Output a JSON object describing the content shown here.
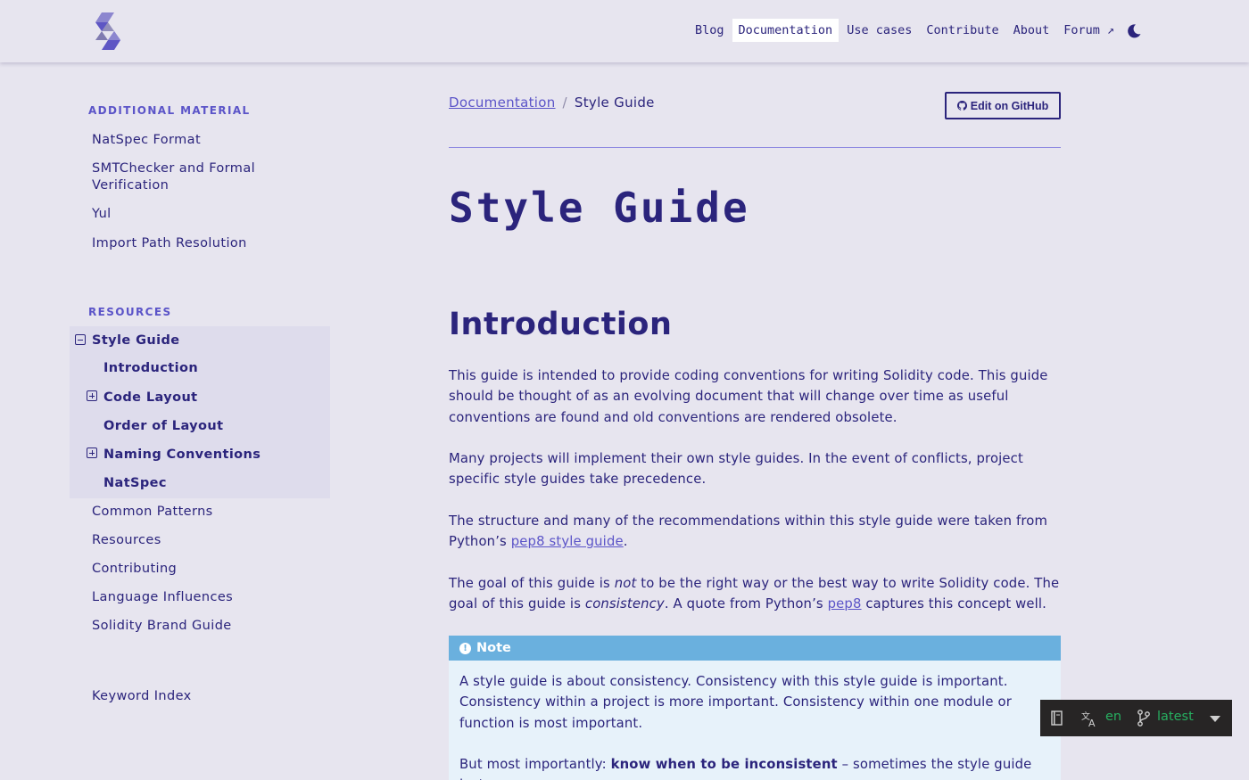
{
  "nav": {
    "items": [
      {
        "label": "Blog",
        "active": false
      },
      {
        "label": "Documentation",
        "active": true
      },
      {
        "label": "Use cases",
        "active": false
      },
      {
        "label": "Contribute",
        "active": false
      },
      {
        "label": "About",
        "active": false
      },
      {
        "label": "Forum ↗",
        "active": false
      }
    ],
    "theme_icon": "moon-icon"
  },
  "sidebar": {
    "additional": {
      "caption": "ADDITIONAL MATERIAL",
      "items": [
        "NatSpec Format",
        "SMTChecker and Formal Verification",
        "Yul",
        "Import Path Resolution"
      ]
    },
    "resources": {
      "caption": "RESOURCES",
      "current": "Style Guide",
      "subitems": [
        "Introduction",
        "Code Layout",
        "Order of Layout",
        "Naming Conventions",
        "NatSpec"
      ],
      "items": [
        "Common Patterns",
        "Resources",
        "Contributing",
        "Language Influences",
        "Solidity Brand Guide"
      ]
    },
    "keyword_index": "Keyword Index"
  },
  "breadcrumb": {
    "parent": "Documentation",
    "sep": "/",
    "current": "Style Guide"
  },
  "edit_button": "Edit on GitHub",
  "page_title": "Style Guide",
  "section_title": "Introduction",
  "paragraphs": {
    "p1": "This guide is intended to provide coding conventions for writing Solidity code. This guide should be thought of as an evolving document that will change over time as useful conventions are found and old conventions are rendered obsolete.",
    "p2": "Many projects will implement their own style guides. In the event of conflicts, project specific style guides take precedence.",
    "p3_a": "The structure and many of the recommendations within this style guide were taken from Python’s ",
    "p3_link": "pep8 style guide",
    "p3_b": ".",
    "p4_a": "The goal of this guide is ",
    "p4_em1": "not",
    "p4_b": " to be the right way or the best way to write Solidity code. The goal of this guide is ",
    "p4_em2": "consistency",
    "p4_c": ". A quote from Python’s ",
    "p4_link": "pep8",
    "p4_d": " captures this concept well."
  },
  "note": {
    "title": "Note",
    "body1": "A style guide is about consistency. Consistency with this style guide is important. Consistency within a project is more important. Consistency within one module or function is most important.",
    "body2_a": "But most importantly: ",
    "body2_strong": "know when to be inconsistent",
    "body2_b": " – sometimes the style guide just"
  },
  "flyout": {
    "language": "en",
    "version": "latest"
  },
  "colors": {
    "background": "#e7e5ef",
    "text": "#2b247c",
    "link": "#5b54c8",
    "note_header": "#6ab0de",
    "note_body": "#e7f2fa",
    "flyout_bg": "#272525",
    "flyout_accent": "#27ae60"
  }
}
